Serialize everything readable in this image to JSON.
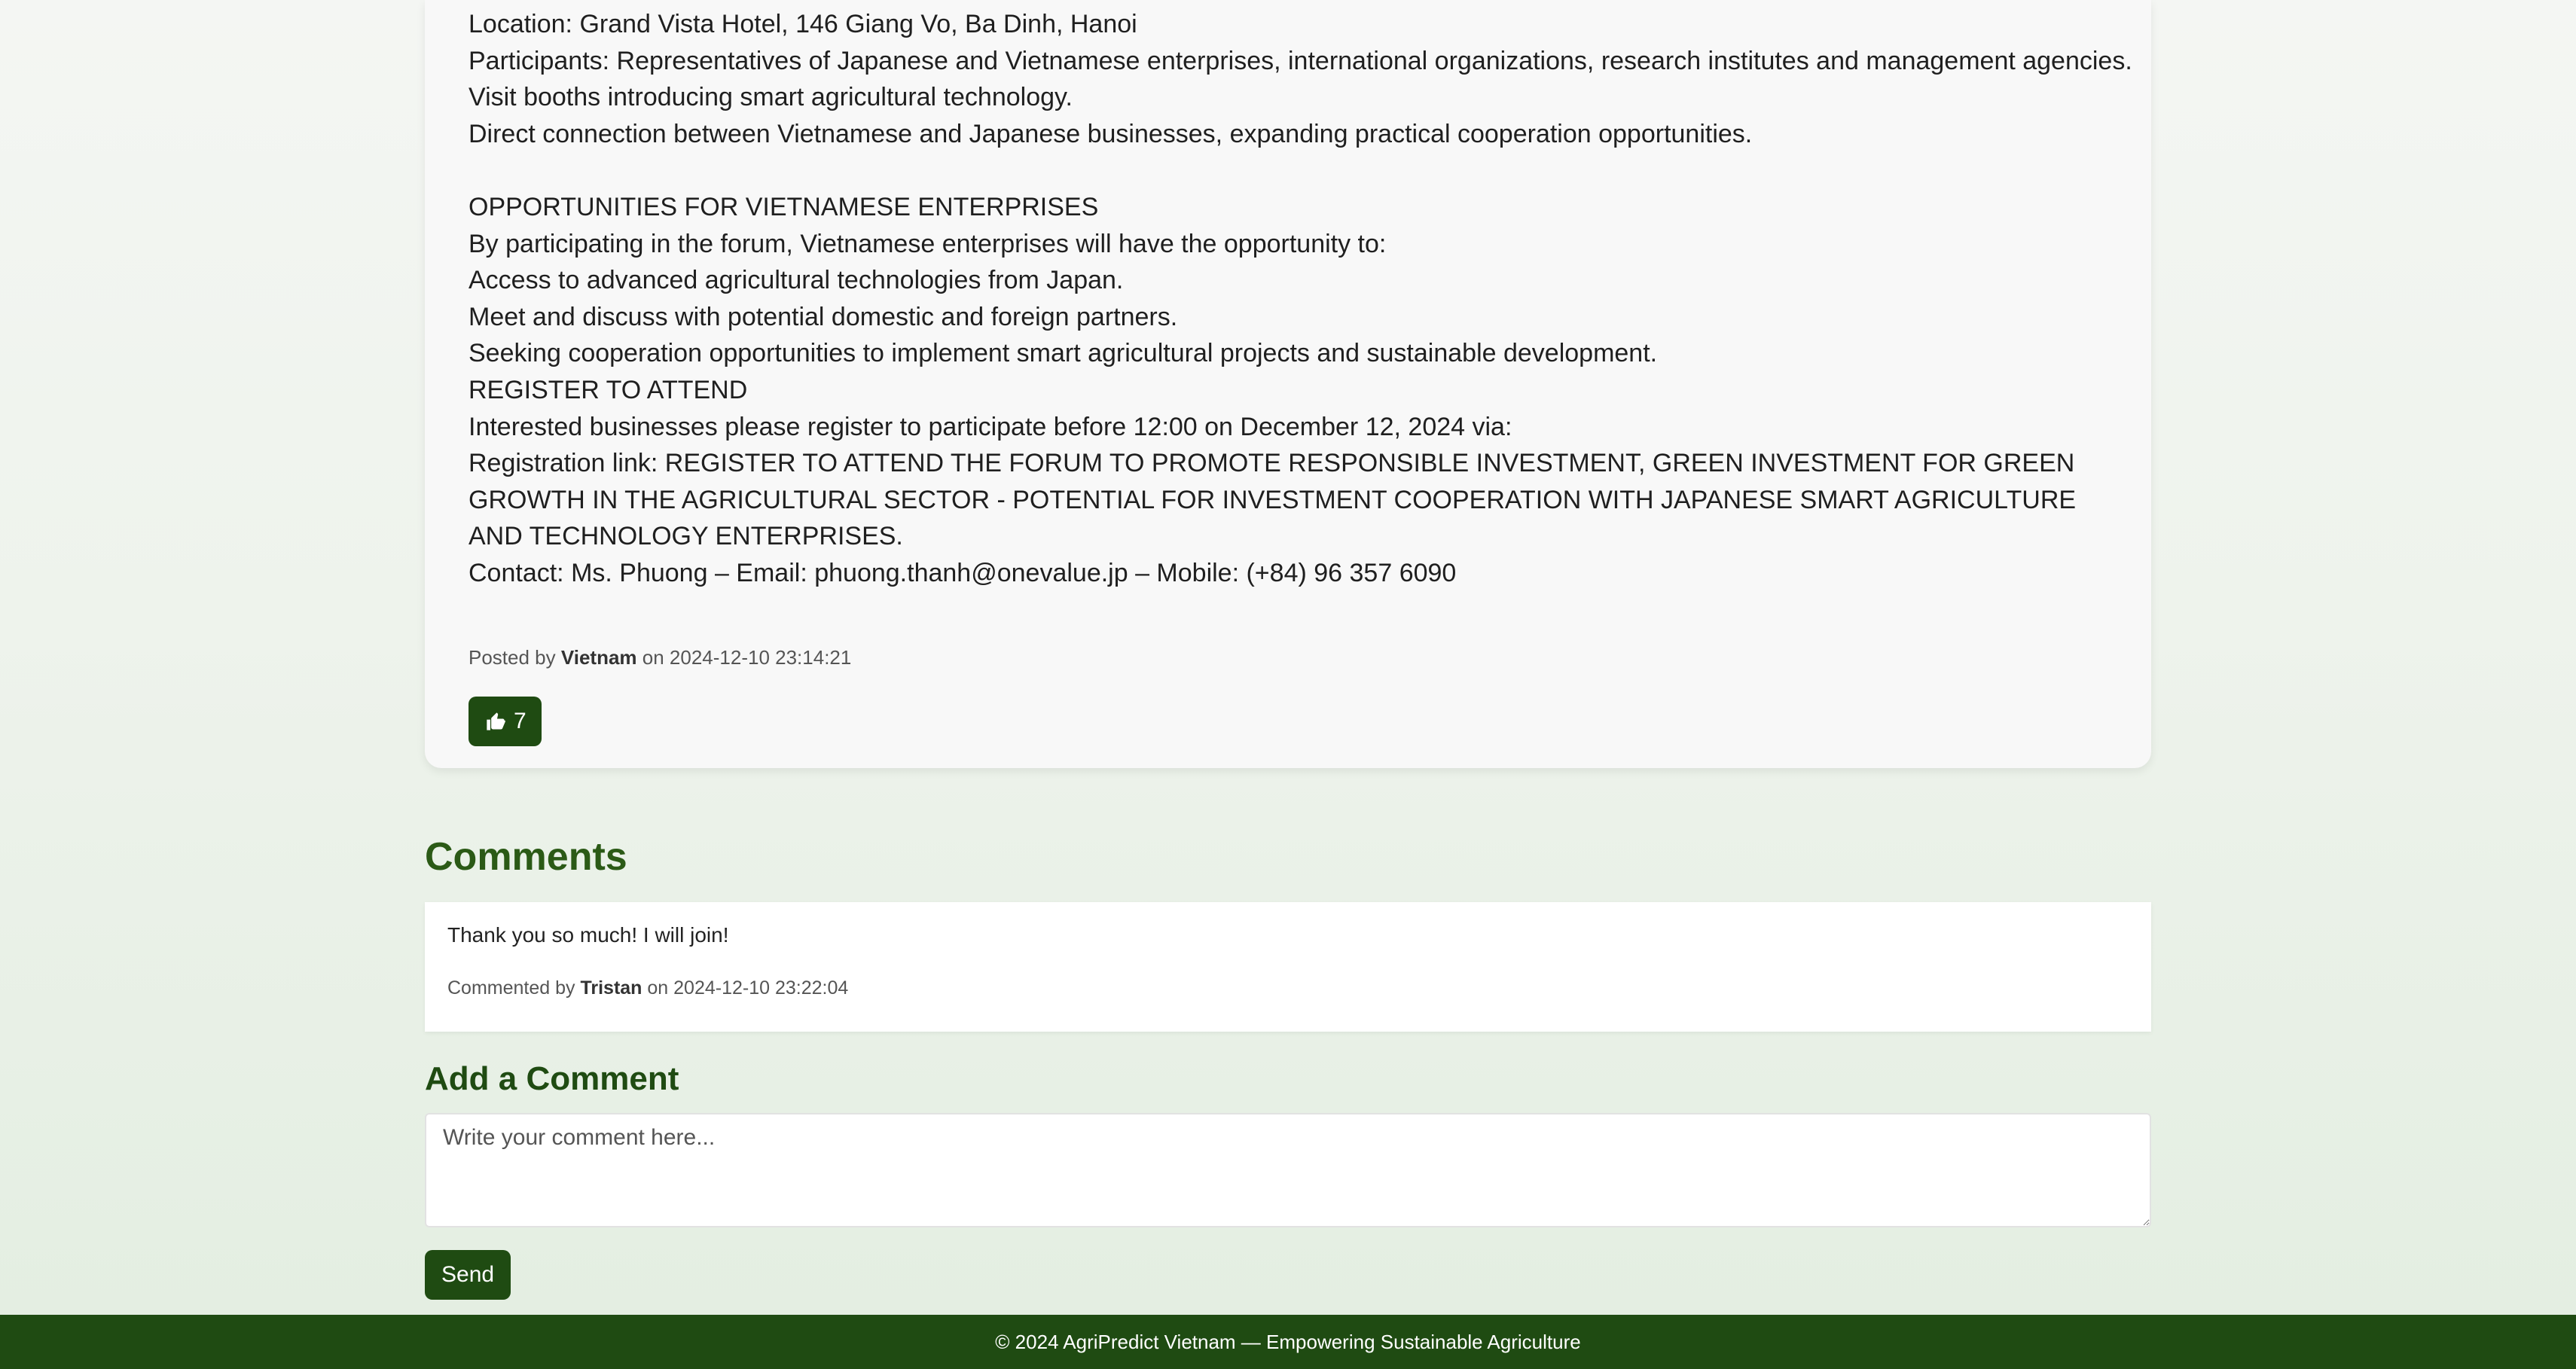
{
  "post": {
    "lines": [
      "Location: Grand Vista Hotel, 146 Giang Vo, Ba Dinh, Hanoi",
      "Participants: Representatives of Japanese and Vietnamese enterprises, international organizations, research institutes and management agencies.",
      "Visit booths introducing smart agricultural technology.",
      "Direct connection between Vietnamese and Japanese businesses, expanding practical cooperation opportunities.",
      "OPPORTUNITIES FOR VIETNAMESE ENTERPRISES",
      "By participating in the forum, Vietnamese enterprises will have the opportunity to:",
      "Access to advanced agricultural technologies from Japan.",
      "Meet and discuss with potential domestic and foreign partners.",
      "Seeking cooperation opportunities to implement smart agricultural projects and sustainable development.",
      "REGISTER TO ATTEND",
      "Interested businesses please register to participate before 12:00 on December 12, 2024 via:",
      "Registration link: REGISTER TO ATTEND THE FORUM TO PROMOTE RESPONSIBLE INVESTMENT, GREEN INVESTMENT FOR GREEN GROWTH IN THE AGRICULTURAL SECTOR - POTENTIAL FOR INVESTMENT COOPERATION WITH JAPANESE SMART AGRICULTURE AND TECHNOLOGY ENTERPRISES.",
      "Contact: Ms. Phuong – Email: phuong.thanh@onevalue.jp – Mobile: (+84) 96 357 6090"
    ],
    "meta_prefix": "Posted by ",
    "author": "Vietnam",
    "meta_mid": " on ",
    "timestamp": "2024-12-10 23:14:21",
    "like_count": "7",
    "like_icon": "thumbs-up-icon"
  },
  "comments": {
    "title": "Comments",
    "items": [
      {
        "text": "Thank you so much! I will join!",
        "meta_prefix": "Commented by ",
        "author": "Tristan",
        "meta_mid": " on ",
        "timestamp": "2024-12-10 23:22:04"
      }
    ]
  },
  "add_comment": {
    "title": "Add a Comment",
    "placeholder": "Write your comment here...",
    "send_label": "Send"
  },
  "footer": {
    "text": "© 2024 AgriPredict Vietnam — Empowering Sustainable Agriculture"
  },
  "colors": {
    "brand_dark": "#1f4b12",
    "heading_green": "#2b5a16"
  }
}
